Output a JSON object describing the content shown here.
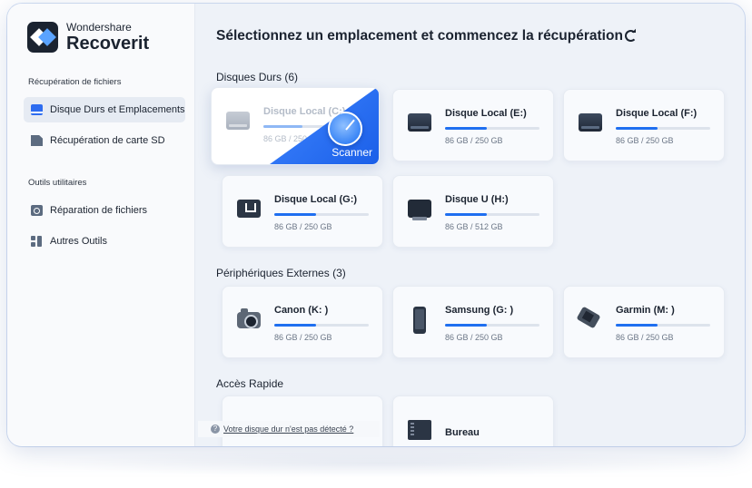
{
  "brand": {
    "company": "Wondershare",
    "product": "Recoverit"
  },
  "sidebar": {
    "section1": "Récupération de fichiers",
    "items1": [
      {
        "label": "Disque Durs et Emplacements",
        "icon": "hard-drive-icon"
      },
      {
        "label": "Récupération de carte SD",
        "icon": "sd-card-icon"
      }
    ],
    "section2": "Outils utilitaires",
    "items2": [
      {
        "label": "Réparation de fichiers",
        "icon": "file-repair-icon"
      },
      {
        "label": "Autres Outils",
        "icon": "grid-tools-icon"
      }
    ]
  },
  "main": {
    "title": "Sélectionnez un emplacement et commencez la récupération",
    "hard_drives": {
      "title": "Disques Durs (6)",
      "items": [
        {
          "name": "Disque Local (C:)",
          "size": "86 GB / 250 GB",
          "usage": 0.41,
          "icon": "hard-drive-icon",
          "selected": true
        },
        {
          "name": "Disque Local (E:)",
          "size": "86 GB / 250 GB",
          "usage": 0.44,
          "icon": "hard-drive-icon"
        },
        {
          "name": "Disque Local (F:)",
          "size": "86 GB / 250 GB",
          "usage": 0.44,
          "icon": "hard-drive-icon"
        },
        {
          "name": "Disque Local (G:)",
          "size": "86 GB / 250 GB",
          "usage": 0.44,
          "icon": "usb-drive-icon"
        },
        {
          "name": "Disque U (H:)",
          "size": "86 GB / 512 GB",
          "usage": 0.44,
          "icon": "usb-stick-icon"
        }
      ]
    },
    "external": {
      "title": "Périphériques Externes (3)",
      "items": [
        {
          "name": "Canon (K: )",
          "size": "86 GB / 250 GB",
          "usage": 0.44,
          "icon": "camera-icon"
        },
        {
          "name": "Samsung (G: )",
          "size": "86 GB / 250 GB",
          "usage": 0.44,
          "icon": "phone-icon"
        },
        {
          "name": "Garmin (M: )",
          "size": "86 GB / 250 GB",
          "usage": 0.44,
          "icon": "gps-device-icon"
        }
      ]
    },
    "quick_access": {
      "title": "Accès Rapide",
      "items": [
        {
          "name": "",
          "icon": ""
        },
        {
          "name": "Bureau",
          "icon": "desktop-folder-icon"
        }
      ]
    },
    "scan_button": "Scanner",
    "help_text": "Votre disque dur n'est pas détecté ?"
  },
  "colors": {
    "accent": "#1f6ff0",
    "sidebar_bg": "#f9fafc",
    "main_bg": "#eef2f8",
    "active_item_bg": "#e6ebf3"
  }
}
